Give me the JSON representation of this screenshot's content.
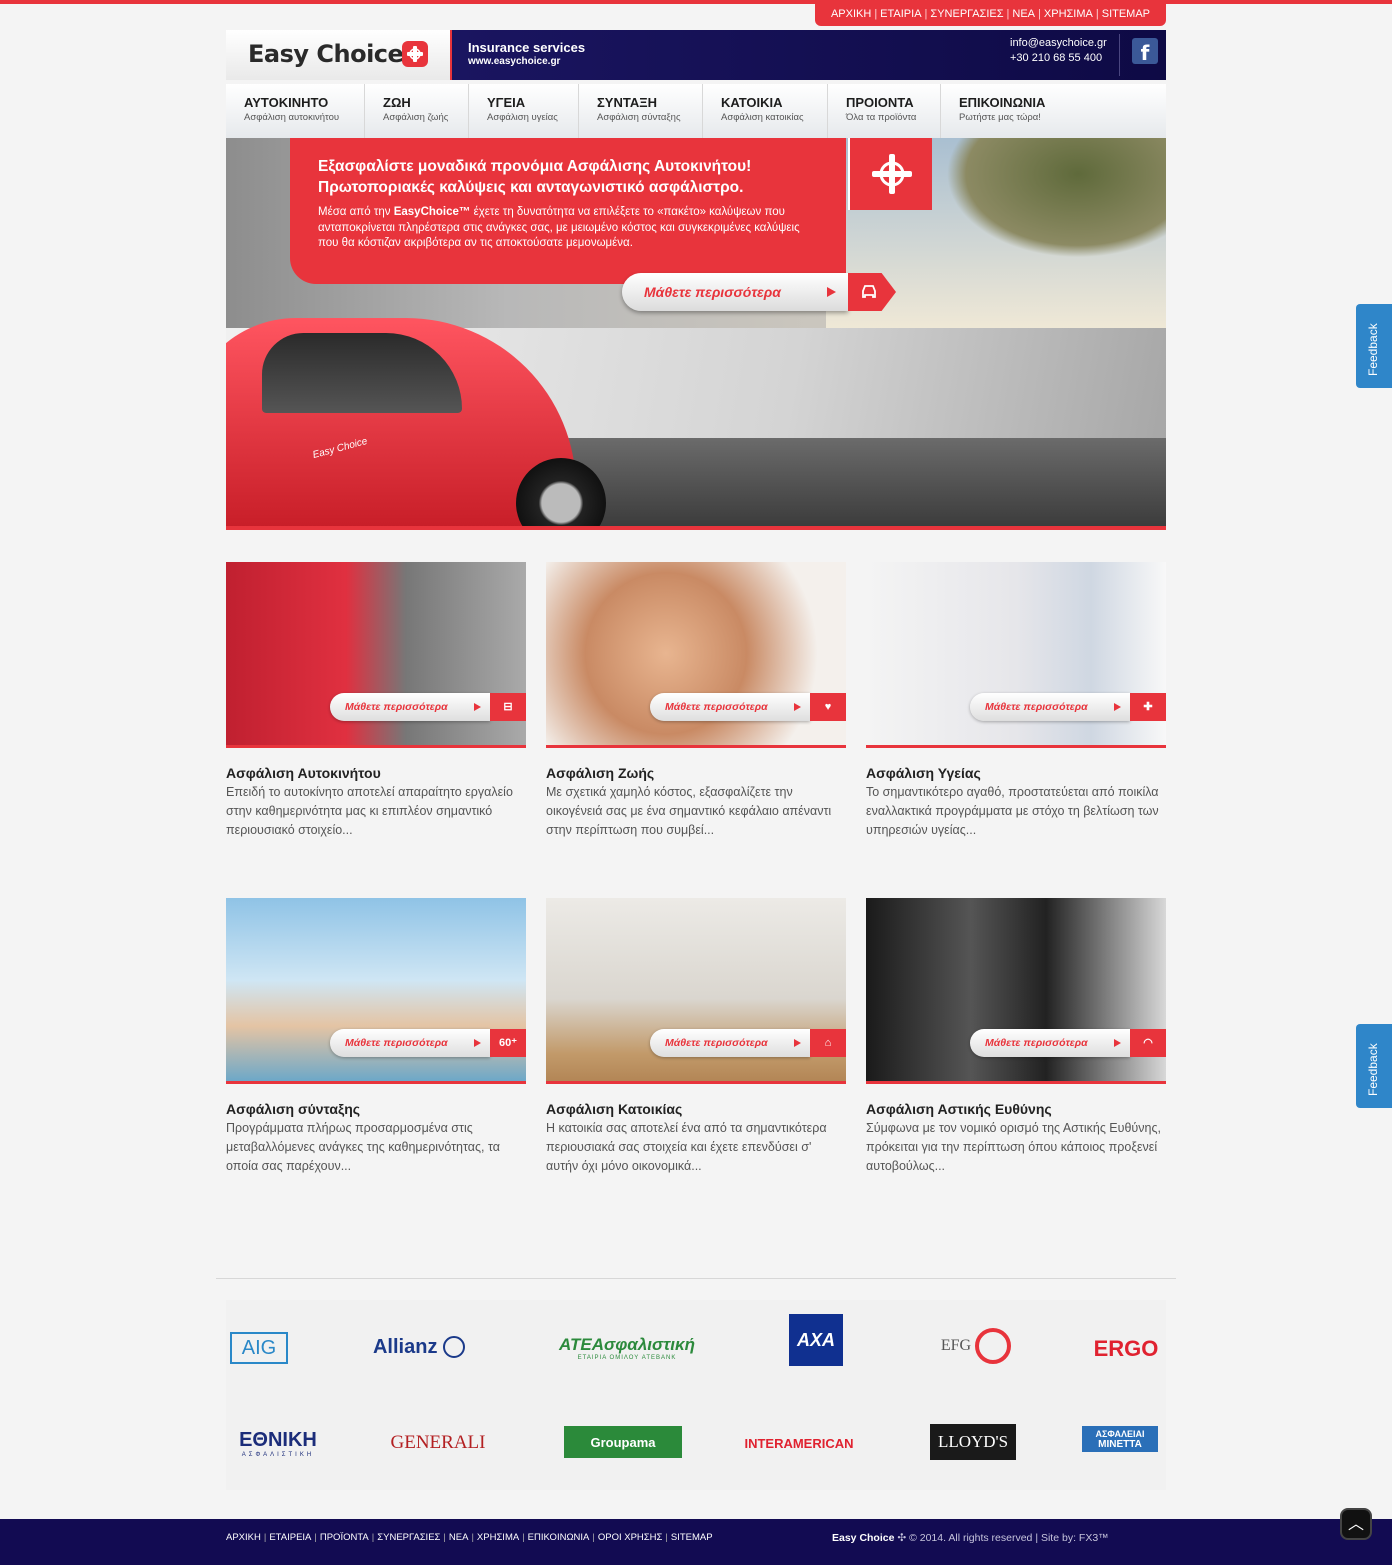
{
  "top_links": [
    "ΑΡΧΙΚΗ",
    "ΕΤΑΙΡΙΑ",
    "ΣΥΝΕΡΓΑΣΙΕΣ",
    "ΝΕΑ",
    "ΧΡΗΣΙΜΑ",
    "SITEMAP"
  ],
  "header": {
    "logo": "Easy Choice",
    "logo_tm": "™",
    "tagline": "Insurance services",
    "website": "www.easychoice.gr",
    "email": "info@easychoice.gr",
    "phone": "+30 210 68 55 400",
    "facebook_glyph": "f"
  },
  "nav": [
    {
      "title": "ΑΥΤΟΚΙΝΗΤΟ",
      "sub": "Ασφάλιση αυτοκινήτου"
    },
    {
      "title": "ΖΩΗ",
      "sub": "Ασφάλιση ζωής"
    },
    {
      "title": "ΥΓΕΙΑ",
      "sub": "Ασφάλιση υγείας"
    },
    {
      "title": "ΣΥΝΤΑΞΗ",
      "sub": "Ασφάλιση σύνταξης"
    },
    {
      "title": "ΚΑΤΟΙΚΙΑ",
      "sub": "Ασφάλιση κατοικίας"
    },
    {
      "title": "ΠΡΟΙΟΝΤΑ",
      "sub": "Όλα τα προϊόντα"
    },
    {
      "title": "ΕΠΙΚΟΙΝΩΝΙΑ",
      "sub": "Ρωτήστε μας τώρα!"
    }
  ],
  "hero": {
    "headline_1": "Εξασφαλίστε μοναδικά προνόμια Ασφάλισης Αυτοκινήτου!",
    "headline_2": "Πρωτοποριακές καλύψεις και ανταγωνιστικό ασφάλιστρο.",
    "body_1": "Μέσα από την ",
    "body_brand": "EasyChoice™",
    "body_2": " έχετε τη δυνατότητα να επιλέξετε το «πακέτο» καλύψεων που ανταποκρίνεται πληρέστερα στις ανάγκες σας, με μειωμένο κόστος και συγκεκριμένες καλύψεις που θα κόστιζαν ακριβότερα αν τις αποκτούσατε μεμονωμένα.",
    "button": "Μάθετε περισσότερα",
    "car_text": "Easy Choice"
  },
  "cards": [
    {
      "title": "Ασφάλιση Αυτοκινήτου",
      "text": "Επειδή το αυτοκίνητο αποτελεί απαραίτητο εργαλείο στην καθημερινότητα μας κι επιπλέον σημαντικό περιουσιακό στοιχείο...",
      "button": "Μάθετε περισσότερα",
      "icon": "car-icon"
    },
    {
      "title": "Ασφάλιση Ζωής",
      "text": "Με σχετικά χαμηλό κόστος, εξασφαλίζετε την οικογένειά σας με ένα σημαντικό κεφάλαιο απέναντι στην περίπτωση που συμβεί...",
      "button": "Μάθετε περισσότερα",
      "icon": "heart-icon"
    },
    {
      "title": "Ασφάλιση Υγείας",
      "text": "Το σημαντικότερο αγαθό, προστατεύεται από ποικίλα εναλλακτικά προγράμματα με στόχο τη βελτίωση των υπηρεσιών υγείας...",
      "button": "Μάθετε περισσότερα",
      "icon": "plus-icon"
    },
    {
      "title": "Ασφάλιση σύνταξης",
      "text": "Προγράμματα πλήρως προσαρμοσμένα στις μεταβαλλόμενες ανάγκες της καθημερινότητας, τα οποία σας παρέχουν...",
      "button": "Μάθετε περισσότερα",
      "icon": "sixty-plus-icon",
      "icon_text": "60⁺"
    },
    {
      "title": "Ασφάλιση Κατοικίας",
      "text": "Η κατοικία σας αποτελεί ένα από τα σημαντικότερα περιουσιακά σας στοιχεία και έχετε επενδύσει σ' αυτήν όχι μόνο οικονομικά...",
      "button": "Μάθετε περισσότερα",
      "icon": "home-icon"
    },
    {
      "title": "Ασφάλιση Αστικής Ευθύνης",
      "text": "Σύμφωνα με τον νομικό ορισμό της Αστικής Ευθύνης, πρόκειται για την περίπτωση όπου κάποιος προξενεί αυτοβούλως...",
      "button": "Μάθετε περισσότερα",
      "icon": "gauge-icon"
    }
  ],
  "partners": [
    "AIG",
    "Allianz",
    "ATEΑσφαλιστική",
    "ΕΤΑΙΡΙΑ ΟΜΙΛΟΥ ATEBANK",
    "AXA",
    "EFG",
    "ERGO",
    "ΕΘΝΙΚΗ",
    "ΑΣΦΑΛΙΣΤΙΚΗ",
    "GENERALI",
    "Groupama",
    "INTERAMERICAN",
    "LLOYD'S",
    "ΑΣΦΑΛΕΙΑΙ",
    "ΜΙΝΕΤΤΑ"
  ],
  "footer": {
    "links": [
      "ΑΡΧΙΚΗ",
      "ΕΤΑΙΡΕΙΑ",
      "ΠΡΟΪΟΝΤΑ",
      "ΣΥΝΕΡΓΑΣΙΕΣ",
      "ΝΕΑ",
      "ΧΡΗΣΙΜΑ",
      "ΕΠΙΚΟΙΝΩΝΙΑ",
      "ΟΡΟΙ ΧΡΗΣΗΣ",
      "SITEMAP"
    ],
    "brand": "Easy Choice",
    "copyright": "© 2014. All rights reserved",
    "site_by": "Site by: FX3™",
    "totop": "︿"
  },
  "feedback": "Feedback",
  "colors": {
    "accent": "#e8343c",
    "navy": "#120b52",
    "feedback": "#2f86c9"
  }
}
